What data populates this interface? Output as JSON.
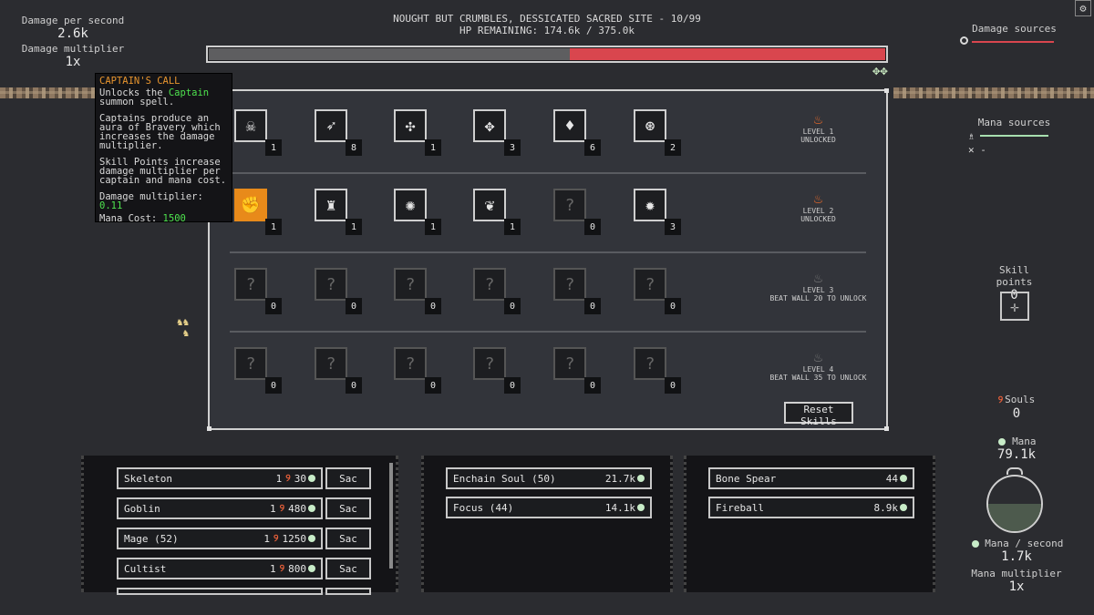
{
  "stats": {
    "dps_label": "Damage per second",
    "dps_value": "2.6k",
    "mult_label": "Damage multiplier",
    "mult_value": "1x"
  },
  "header": {
    "title": "NOUGHT BUT CRUMBLES, DESSICATED SACRED SITE - 10/99",
    "hp": "HP REMAINING: 174.6k / 375.0k",
    "hp_fraction": 0.466
  },
  "right": {
    "damage_sources_label": "Damage sources",
    "mana_sources_label": "Mana sources",
    "mana_row2": "-",
    "skill_points_label": "Skill points",
    "skill_points_value": "0",
    "souls_label": "Souls",
    "souls_value": "0",
    "mana_label": "Mana",
    "mana_value": "79.1k",
    "mana_fill": 0.5,
    "mana_ps_label": "Mana / second",
    "mana_ps_value": "1.7k",
    "mana_mult_label": "Mana multiplier",
    "mana_mult_value": "1x"
  },
  "tooltip": {
    "title": "CAPTAIN'S CALL",
    "line1_a": "Unlocks the ",
    "line1_b": "Captain",
    "line1_c": " summon spell.",
    "para2": "Captains produce an aura of Bravery which increases the damage multiplier.",
    "para3": "Skill Points increase damage multiplier per captain and mana cost.",
    "dm_label": "Damage multiplier: ",
    "dm_value": "0.11",
    "mc_label": "Mana Cost: ",
    "mc_value": "1500"
  },
  "levels": [
    {
      "line1": "LEVEL 1",
      "line2": "UNLOCKED",
      "unlocked": true
    },
    {
      "line1": "LEVEL 2",
      "line2": "UNLOCKED",
      "unlocked": true
    },
    {
      "line1": "LEVEL 3",
      "line2": "BEAT WALL 20 TO UNLOCK",
      "unlocked": false
    },
    {
      "line1": "LEVEL 4",
      "line2": "BEAT WALL 35 TO UNLOCK",
      "unlocked": false
    }
  ],
  "skills": [
    [
      {
        "icon": "skull-icon",
        "glyph": "☠",
        "count": "1"
      },
      {
        "icon": "arrow-icon",
        "glyph": "➶",
        "count": "8"
      },
      {
        "icon": "compress-icon",
        "glyph": "✣",
        "count": "1"
      },
      {
        "icon": "winged-icon",
        "glyph": "✥",
        "count": "3"
      },
      {
        "icon": "drops-icon",
        "glyph": "♦",
        "count": "6"
      },
      {
        "icon": "target-icon",
        "glyph": "⊛",
        "count": "2"
      }
    ],
    [
      {
        "icon": "fist-icon",
        "glyph": "✊",
        "count": "1",
        "active": true
      },
      {
        "icon": "figures-icon",
        "glyph": "♜",
        "count": "1"
      },
      {
        "icon": "burst-icon",
        "glyph": "✺",
        "count": "1"
      },
      {
        "icon": "feather-icon",
        "glyph": "❦",
        "count": "1"
      },
      {
        "icon": "unknown-icon",
        "glyph": "?",
        "count": "0",
        "locked": true
      },
      {
        "icon": "starburst-icon",
        "glyph": "✹",
        "count": "3"
      }
    ],
    [
      {
        "icon": "unknown-icon",
        "glyph": "?",
        "count": "0",
        "locked": true
      },
      {
        "icon": "unknown-icon",
        "glyph": "?",
        "count": "0",
        "locked": true
      },
      {
        "icon": "unknown-icon",
        "glyph": "?",
        "count": "0",
        "locked": true
      },
      {
        "icon": "unknown-icon",
        "glyph": "?",
        "count": "0",
        "locked": true
      },
      {
        "icon": "unknown-icon",
        "glyph": "?",
        "count": "0",
        "locked": true
      },
      {
        "icon": "unknown-icon",
        "glyph": "?",
        "count": "0",
        "locked": true
      }
    ],
    [
      {
        "icon": "unknown-icon",
        "glyph": "?",
        "count": "0",
        "locked": true
      },
      {
        "icon": "unknown-icon",
        "glyph": "?",
        "count": "0",
        "locked": true
      },
      {
        "icon": "unknown-icon",
        "glyph": "?",
        "count": "0",
        "locked": true
      },
      {
        "icon": "unknown-icon",
        "glyph": "?",
        "count": "0",
        "locked": true
      },
      {
        "icon": "unknown-icon",
        "glyph": "?",
        "count": "0",
        "locked": true
      },
      {
        "icon": "unknown-icon",
        "glyph": "?",
        "count": "0",
        "locked": true
      }
    ]
  ],
  "reset_label": "Reset Skills",
  "summons": [
    {
      "name": "Skeleton",
      "souls": "1",
      "cost": "30",
      "sac": "Sac"
    },
    {
      "name": "Goblin",
      "souls": "1",
      "cost": "480",
      "sac": "Sac"
    },
    {
      "name": "Mage (52)",
      "souls": "1",
      "cost": "1250",
      "sac": "Sac"
    },
    {
      "name": "Cultist",
      "souls": "1",
      "cost": "800",
      "sac": "Sac"
    }
  ],
  "enchants": [
    {
      "name": "Enchain Soul (50)",
      "cost": "21.7k"
    },
    {
      "name": "Focus (44)",
      "cost": "14.1k"
    }
  ],
  "spells": [
    {
      "name": "Bone Spear",
      "cost": "44"
    },
    {
      "name": "Fireball",
      "cost": "8.9k"
    }
  ]
}
